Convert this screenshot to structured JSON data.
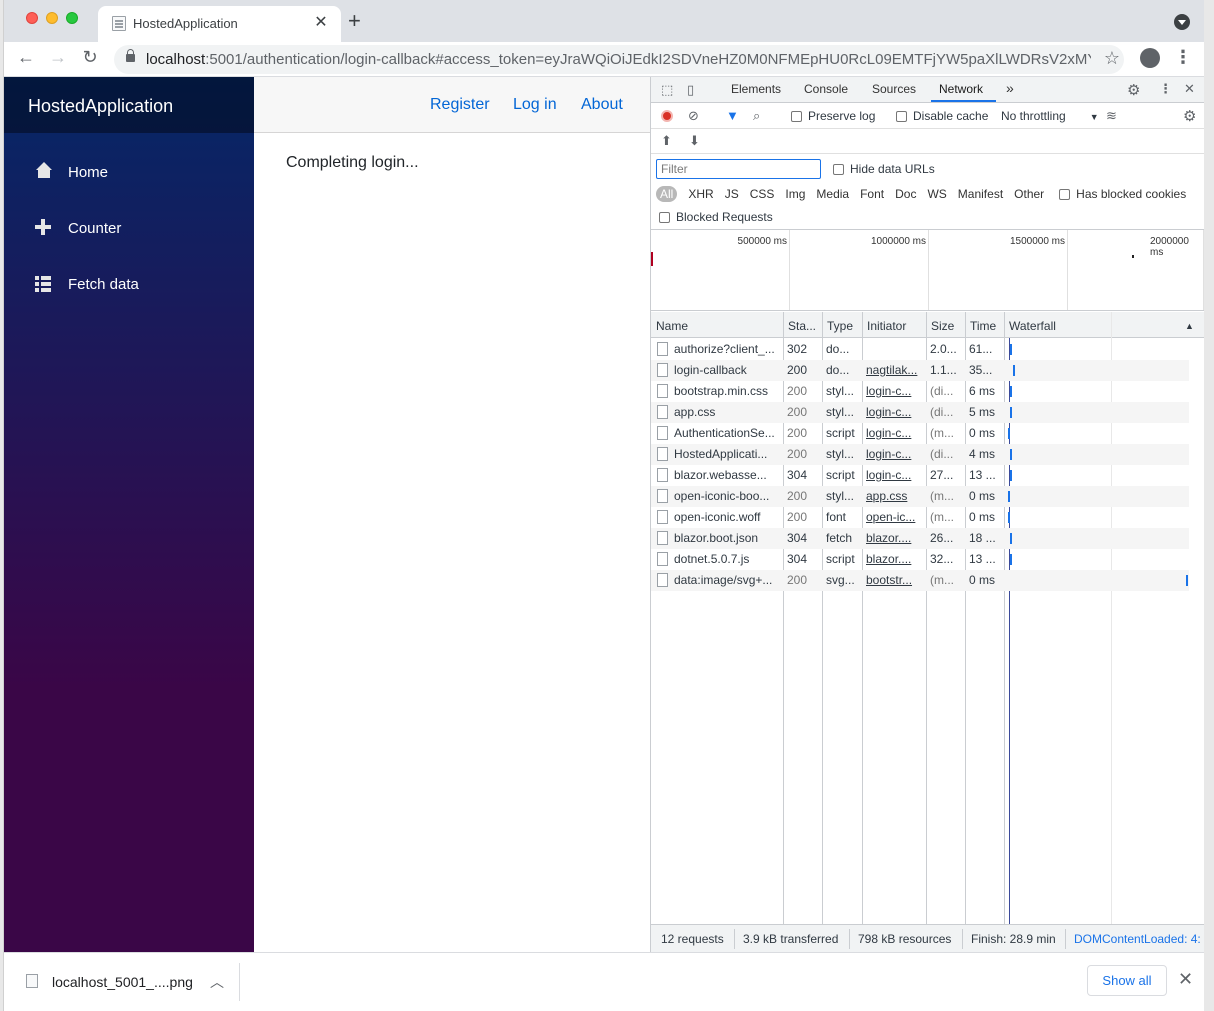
{
  "browser": {
    "tab_title": "HostedApplication",
    "tab_close": "✕",
    "new_tab": "+",
    "url_host": "localhost",
    "url_rest": ":5001/authentication/login-callback#access_token=eyJraWQiOiJEdkI2SDVneHZ0M0NFMEpHU0RcL09EMTFjYW5paXlLWDRsV2xMY...",
    "back": "←",
    "forward": "→",
    "reload": "↻",
    "star": "☆",
    "menu": "⋮"
  },
  "app": {
    "brand": "HostedApplication",
    "nav": [
      {
        "label": "Home"
      },
      {
        "label": "Counter"
      },
      {
        "label": "Fetch data"
      }
    ],
    "top_links": {
      "register": "Register",
      "login": "Log in",
      "about": "About"
    },
    "content": "Completing login..."
  },
  "devtools": {
    "tabs": [
      "Elements",
      "Console",
      "Sources",
      "Network"
    ],
    "more": "»",
    "preserve_log": "Preserve log",
    "disable_cache": "Disable cache",
    "throttling": "No throttling",
    "filter_placeholder": "Filter",
    "hide_data_urls": "Hide data URLs",
    "type_filters": [
      "All",
      "XHR",
      "JS",
      "CSS",
      "Img",
      "Media",
      "Font",
      "Doc",
      "WS",
      "Manifest",
      "Other"
    ],
    "has_blocked_cookies": "Has blocked cookies",
    "blocked_requests": "Blocked Requests",
    "timeline_ticks": [
      "500000 ms",
      "1000000 ms",
      "1500000 ms",
      "2000000 ms"
    ],
    "columns": {
      "name": "Name",
      "status": "Sta...",
      "type": "Type",
      "initiator": "Initiator",
      "size": "Size",
      "time": "Time",
      "waterfall": "Waterfall"
    },
    "rows": [
      {
        "name": "authorize?client_...",
        "status": "302",
        "type": "do...",
        "initiator": "",
        "size": "2.0...",
        "time": "61..."
      },
      {
        "name": "login-callback",
        "status": "200",
        "type": "do...",
        "initiator": "nagtilak...",
        "size": "1.1...",
        "time": "35..."
      },
      {
        "name": "bootstrap.min.css",
        "status": "200",
        "type": "styl...",
        "initiator": "login-c...",
        "size": "(di...",
        "time": "6 ms"
      },
      {
        "name": "app.css",
        "status": "200",
        "type": "styl...",
        "initiator": "login-c...",
        "size": "(di...",
        "time": "5 ms"
      },
      {
        "name": "AuthenticationSe...",
        "status": "200",
        "type": "script",
        "initiator": "login-c...",
        "size": "(m...",
        "time": "0 ms"
      },
      {
        "name": "HostedApplicati...",
        "status": "200",
        "type": "styl...",
        "initiator": "login-c...",
        "size": "(di...",
        "time": "4 ms"
      },
      {
        "name": "blazor.webasse...",
        "status": "304",
        "type": "script",
        "initiator": "login-c...",
        "size": "27...",
        "time": "13 ..."
      },
      {
        "name": "open-iconic-boo...",
        "status": "200",
        "type": "styl...",
        "initiator": "app.css",
        "size": "(m...",
        "time": "0 ms"
      },
      {
        "name": "open-iconic.woff",
        "status": "200",
        "type": "font",
        "initiator": "open-ic...",
        "size": "(m...",
        "time": "0 ms"
      },
      {
        "name": "blazor.boot.json",
        "status": "304",
        "type": "fetch",
        "initiator": "blazor....",
        "size": "26...",
        "time": "18 ..."
      },
      {
        "name": "dotnet.5.0.7.js",
        "status": "304",
        "type": "script",
        "initiator": "blazor....",
        "size": "32...",
        "time": "13 ..."
      },
      {
        "name": "data:image/svg+...",
        "status": "200",
        "type": "svg...",
        "initiator": "bootstr...",
        "size": "(m...",
        "time": "0 ms"
      }
    ],
    "status": {
      "requests": "12 requests",
      "transferred": "3.9 kB transferred",
      "resources": "798 kB resources",
      "finish": "Finish: 28.9 min",
      "dcl": "DOMContentLoaded: 4:"
    }
  },
  "downloads": {
    "file": "localhost_5001_....png",
    "show_all": "Show all",
    "close": "✕"
  }
}
